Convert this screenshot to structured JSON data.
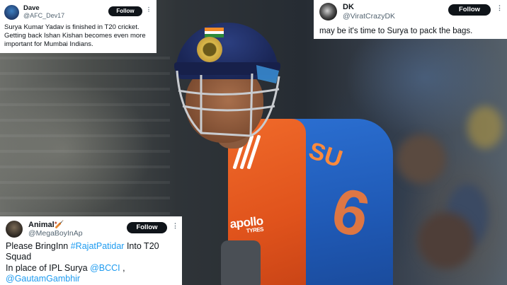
{
  "tweets": [
    {
      "name": "Dave",
      "handle": "@AFC_Dev17",
      "follow_label": "Follow",
      "more_label": "⋮",
      "text": "Surya Kumar Yadav is finished in T20 cricket. Getting back Ishan Kishan becomes even more important for Mumbai Indians."
    },
    {
      "name": "DK",
      "handle": "@ViratCrazyDK",
      "follow_label": "Follow",
      "more_label": "⋮",
      "text": "may be it's time to Surya to pack the bags."
    },
    {
      "name": "Animal🏏",
      "handle": "@MegaBoyInAp",
      "follow_label": "Follow",
      "more_label": "⋮",
      "text_parts": {
        "p1": "Please BringInn ",
        "m1": "#RajatPatidar",
        "p2": " Into T20 Squad",
        "p3": "In place of  IPL Surya ",
        "m2": "@BCCI",
        "p4": " ,",
        "m3": "@GautamGambhir"
      }
    }
  ],
  "photo": {
    "jersey_name": "SU",
    "jersey_number": "6",
    "sponsor": "apollo",
    "sponsor_sub": "TYRES",
    "colors": {
      "jersey_orange": "#f06a2a",
      "jersey_blue": "#2b6fd1",
      "helmet": "#1a2656",
      "mention": "#1d9bf0"
    }
  }
}
